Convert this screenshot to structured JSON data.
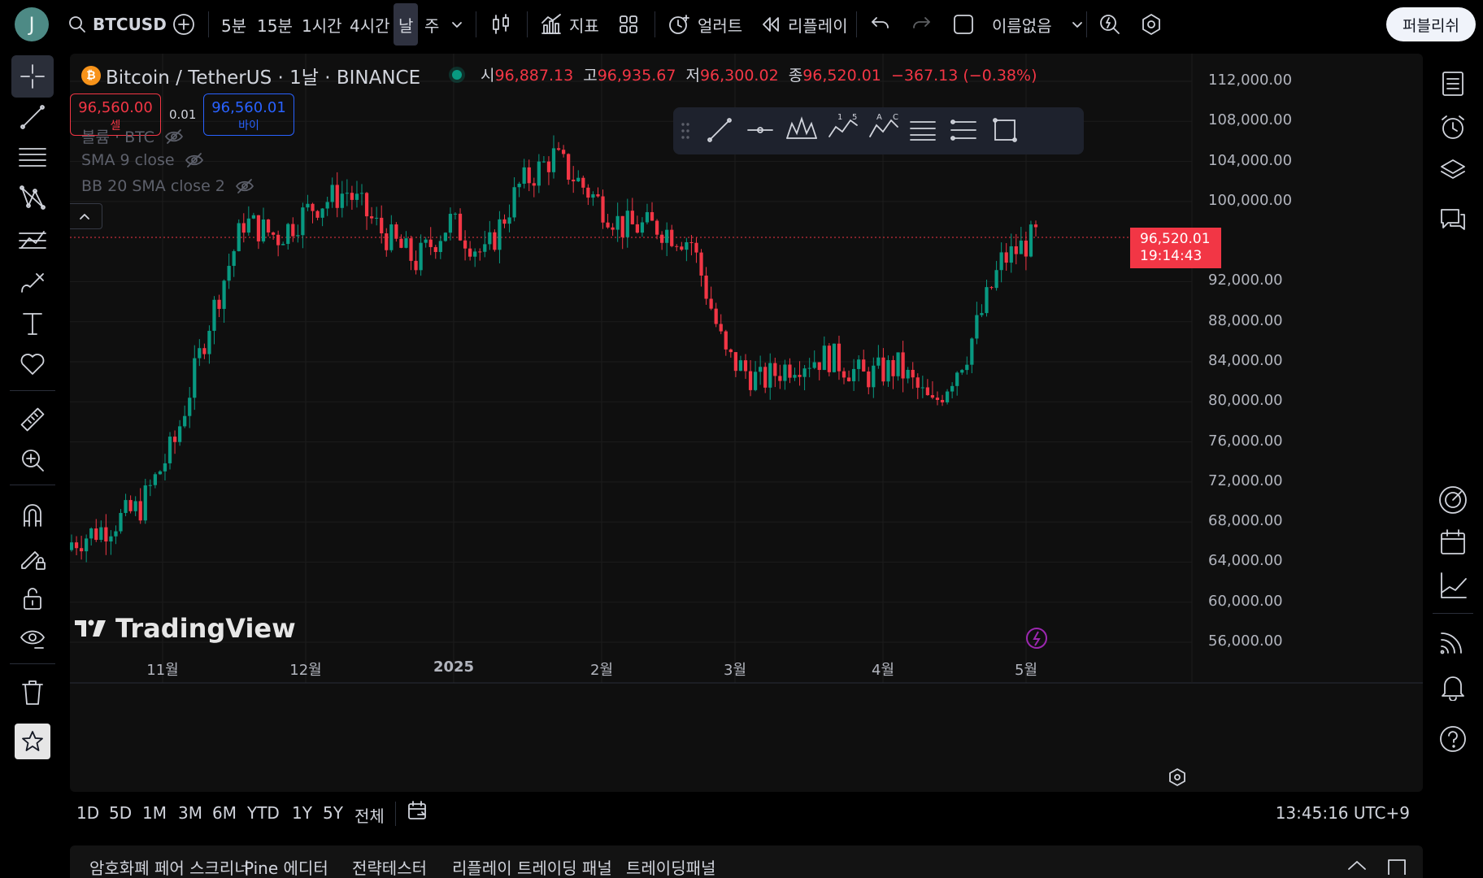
{
  "topbar": {
    "avatar_letter": "J",
    "symbol": "BTCUSD",
    "timeframes": [
      "5분",
      "15분",
      "1시간",
      "4시간",
      "날",
      "주"
    ],
    "active_timeframe": "날",
    "indicators_label": "지표",
    "alert_label": "얼러트",
    "replay_label": "리플레이",
    "layout_name": "이름없음",
    "publish_label": "퍼블리쉬"
  },
  "legend": {
    "title": "Bitcoin / TetherUS · 1날 · BINANCE",
    "o_label": "시",
    "o_value": "96,887.13",
    "h_label": "고",
    "h_value": "96,935.67",
    "l_label": "저",
    "l_value": "96,300.02",
    "c_label": "종",
    "c_value": "96,520.01",
    "change": "−367.13 (−0.38%)",
    "sell_price": "96,560.00",
    "sell_label": "셀",
    "spread": "0.01",
    "buy_price": "96,560.01",
    "buy_label": "바이",
    "indicators": [
      "볼륨 · BTC",
      "SMA 9 close",
      "BB 20 SMA close 2"
    ]
  },
  "yaxis": [
    "112,000.00",
    "108,000.00",
    "104,000.00",
    "100,000.00",
    "92,000.00",
    "88,000.00",
    "84,000.00",
    "80,000.00",
    "76,000.00",
    "72,000.00",
    "68,000.00",
    "64,000.00",
    "60,000.00",
    "56,000.00"
  ],
  "xaxis": [
    "11월",
    "12월",
    "2025",
    "2월",
    "3월",
    "4월",
    "5월"
  ],
  "last_price": {
    "price": "96,520.01",
    "countdown": "19:14:43"
  },
  "brand": "TradingView",
  "rangebar": {
    "ranges": [
      "1D",
      "5D",
      "1M",
      "3M",
      "6M",
      "YTD",
      "1Y",
      "5Y",
      "전체"
    ],
    "clock": "13:45:16 UTC+9"
  },
  "bottom_tabs": [
    "암호화폐 페어 스크리너",
    "Pine 에디터",
    "전략테스터",
    "리플레이 트레이딩 패널",
    "트레이딩패널"
  ],
  "colors": {
    "up": "#089981",
    "down": "#f23645",
    "buy": "#2962ff",
    "bg": "#0f0f0f"
  },
  "chart_data": {
    "type": "candlestick",
    "ohlc_daily_close_approx": [
      [
        "2024-10-14",
        66000
      ],
      [
        "2024-10-21",
        67500
      ],
      [
        "2024-10-28",
        69500
      ],
      [
        "2024-11-04",
        76000
      ],
      [
        "2024-11-11",
        88000
      ],
      [
        "2024-11-18",
        98000
      ],
      [
        "2024-11-25",
        96500
      ],
      [
        "2024-12-02",
        99500
      ],
      [
        "2024-12-09",
        101000
      ],
      [
        "2024-12-16",
        97000
      ],
      [
        "2024-12-23",
        94000
      ],
      [
        "2024-12-30",
        98000
      ],
      [
        "2025-01-06",
        94500
      ],
      [
        "2025-01-13",
        101500
      ],
      [
        "2025-01-20",
        104500
      ],
      [
        "2025-01-27",
        101000
      ],
      [
        "2025-02-03",
        97500
      ],
      [
        "2025-02-10",
        97500
      ],
      [
        "2025-02-17",
        96000
      ],
      [
        "2025-02-24",
        84500
      ],
      [
        "2025-03-03",
        82000
      ],
      [
        "2025-03-10",
        84000
      ],
      [
        "2025-03-17",
        84500
      ],
      [
        "2025-03-24",
        82500
      ],
      [
        "2025-03-31",
        83500
      ],
      [
        "2025-04-07",
        79500
      ],
      [
        "2025-04-14",
        85000
      ],
      [
        "2025-04-21",
        94000
      ],
      [
        "2025-04-28",
        96520
      ]
    ],
    "ylim": [
      56000,
      112000
    ]
  }
}
